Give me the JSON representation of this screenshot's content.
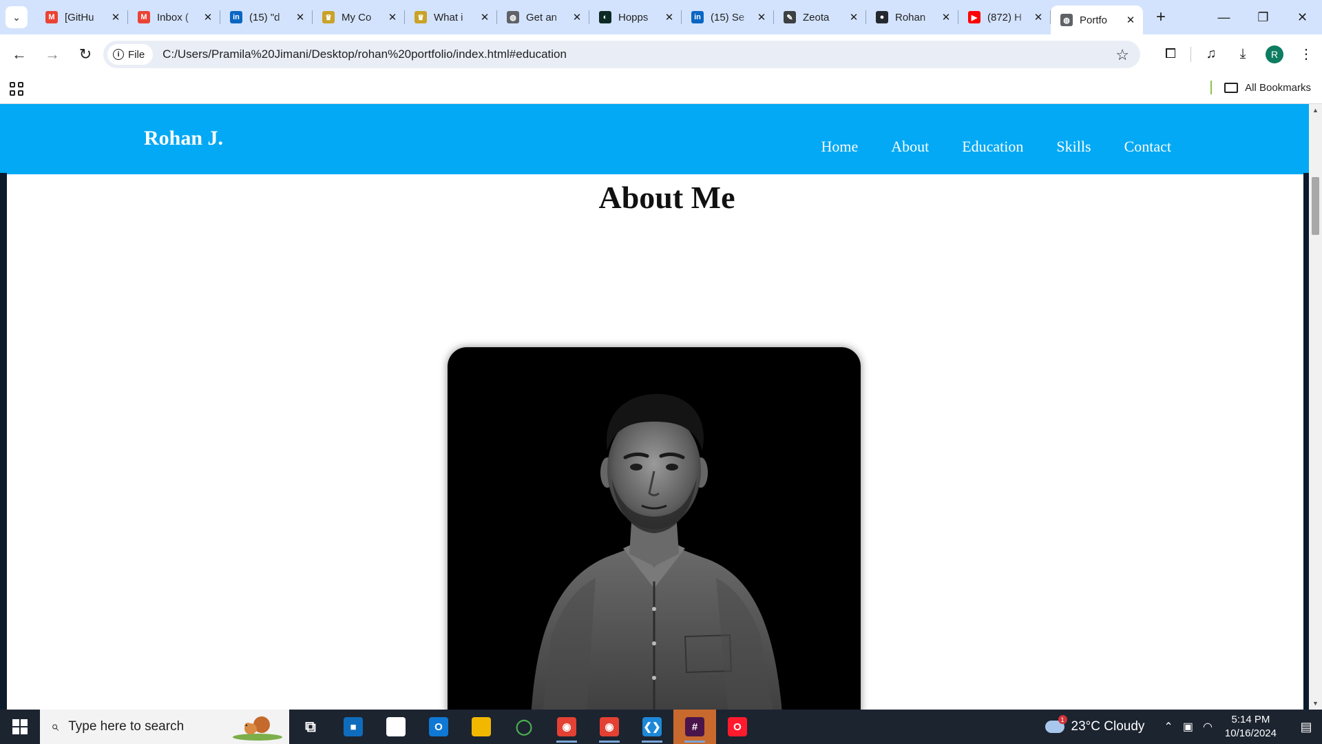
{
  "browser": {
    "tabs": [
      {
        "title": "[GitHu",
        "favicon": "gmail-icon",
        "color": "#ea4335",
        "glyph": "M"
      },
      {
        "title": "Inbox (",
        "favicon": "gmail-icon",
        "color": "#ea4335",
        "glyph": "M"
      },
      {
        "title": "(15) \"d",
        "favicon": "linkedin-icon",
        "color": "#0a66c2",
        "glyph": "in"
      },
      {
        "title": "My Co",
        "favicon": "crown-icon",
        "color": "#c9a227",
        "glyph": "♛"
      },
      {
        "title": "What i",
        "favicon": "crown-icon",
        "color": "#c9a227",
        "glyph": "♛"
      },
      {
        "title": "Get an",
        "favicon": "globe-icon",
        "color": "#5f6368",
        "glyph": "◍"
      },
      {
        "title": "Hopps",
        "favicon": "hoppscotch-icon",
        "color": "#0d2a24",
        "glyph": "◐"
      },
      {
        "title": "(15) Se",
        "favicon": "linkedin-icon",
        "color": "#0a66c2",
        "glyph": "in"
      },
      {
        "title": "Zeota",
        "favicon": "zeotap-icon",
        "color": "#3c4043",
        "glyph": "✎"
      },
      {
        "title": "Rohan",
        "favicon": "github-icon",
        "color": "#24292f",
        "glyph": "●"
      },
      {
        "title": "(872) H",
        "favicon": "youtube-icon",
        "color": "#ff0000",
        "glyph": "▶"
      },
      {
        "title": "Portfo",
        "favicon": "globe-icon",
        "color": "#5f6368",
        "glyph": "◍",
        "active": true
      }
    ],
    "address": {
      "chip_label": "File",
      "url": "C:/Users/Pramila%20Jimani/Desktop/rohan%20portfolio/index.html#education"
    },
    "profile_initial": "R",
    "bookmarks_label": "All Bookmarks"
  },
  "site": {
    "brand": "Rohan J.",
    "nav": [
      "Home",
      "About",
      "Education",
      "Skills",
      "Contact"
    ],
    "section_title": "About Me",
    "photo_alt": "profile photo"
  },
  "taskbar": {
    "search_placeholder": "Type here to search",
    "apps": [
      {
        "name": "task-view-icon",
        "glyph": "⧉",
        "bg": "transparent"
      },
      {
        "name": "microsoft-store-icon",
        "glyph": "■",
        "bg": "#0f6cbd"
      },
      {
        "name": "notepad-icon",
        "glyph": "",
        "bg": "#ffffff"
      },
      {
        "name": "outlook-icon",
        "glyph": "O",
        "bg": "#0f78d4"
      },
      {
        "name": "file-explorer-icon",
        "glyph": "",
        "bg": "#f2b800"
      },
      {
        "name": "app-ring-icon",
        "glyph": "◯",
        "bg": "transparent"
      },
      {
        "name": "chrome-icon",
        "glyph": "◉",
        "bg": "#e34133"
      },
      {
        "name": "chrome-profile-icon",
        "glyph": "◉",
        "bg": "#e34133"
      },
      {
        "name": "vscode-icon",
        "glyph": "❮❯",
        "bg": "#1e88d8"
      },
      {
        "name": "slack-icon",
        "glyph": "#",
        "bg": "#4a154b"
      },
      {
        "name": "opera-icon",
        "glyph": "O",
        "bg": "#ff1b2d"
      }
    ],
    "weather": "23°C  Cloudy",
    "weather_badge": "1",
    "time": "5:14 PM",
    "date": "10/16/2024"
  }
}
